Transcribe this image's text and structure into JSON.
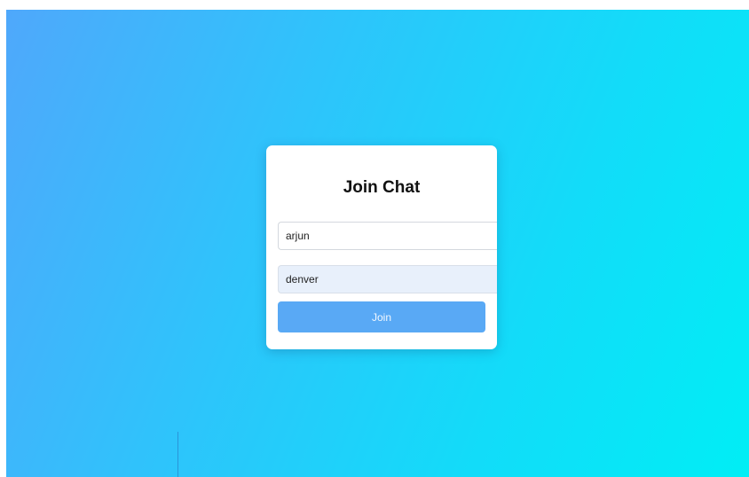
{
  "page": {
    "background_colors": [
      "#4fa8fb",
      "#2fc3fb",
      "#12dcf9",
      "#00eef5"
    ]
  },
  "join_card": {
    "title": "Join Chat",
    "name_field": {
      "value": "arjun",
      "placeholder": ""
    },
    "room_field": {
      "value": "denver",
      "placeholder": ""
    },
    "join_button": {
      "label": "Join",
      "color": "#59a9f5"
    }
  }
}
